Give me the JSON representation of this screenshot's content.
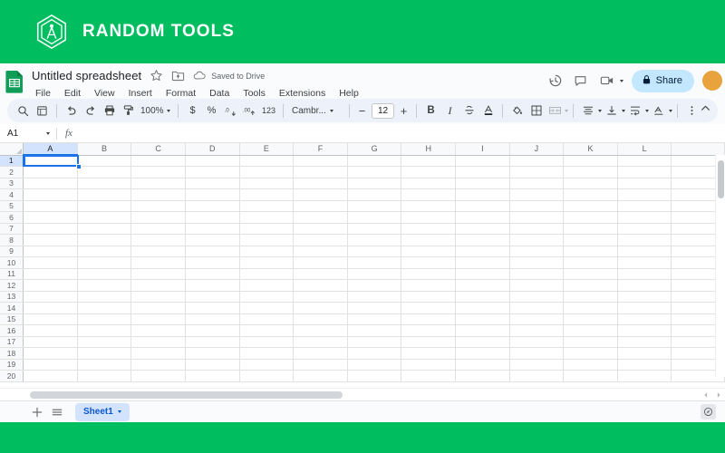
{
  "brand": {
    "name": "RANDOM TOOLS",
    "logo_icon": "hexagon-compass-icon",
    "banner_color": "#00bd60"
  },
  "document": {
    "app_icon": "google-sheets-icon",
    "title": "Untitled spreadsheet",
    "star_icon": "star-icon",
    "move_icon": "move-to-folder-icon",
    "cloud_icon": "cloud-saved-icon",
    "save_status": "Saved to Drive"
  },
  "menubar": {
    "items": [
      {
        "label": "File",
        "name": "menu-file"
      },
      {
        "label": "Edit",
        "name": "menu-edit"
      },
      {
        "label": "View",
        "name": "menu-view"
      },
      {
        "label": "Insert",
        "name": "menu-insert"
      },
      {
        "label": "Format",
        "name": "menu-format"
      },
      {
        "label": "Data",
        "name": "menu-data"
      },
      {
        "label": "Tools",
        "name": "menu-tools"
      },
      {
        "label": "Extensions",
        "name": "menu-extensions"
      },
      {
        "label": "Help",
        "name": "menu-help"
      }
    ]
  },
  "header_actions": {
    "history_icon": "version-history-icon",
    "comment_icon": "comment-icon",
    "meet_icon": "video-call-icon",
    "share_label": "Share",
    "share_lock_icon": "lock-icon",
    "share_bg": "#c2e7ff",
    "avatar_color": "#e8a33d"
  },
  "toolbar": {
    "search_icon": "search-icon",
    "menus_icon": "all-menus-icon",
    "undo_icon": "undo-icon",
    "redo_icon": "redo-icon",
    "print_icon": "print-icon",
    "paint_icon": "paint-format-icon",
    "zoom_value": "100%",
    "currency_label": "$",
    "percent_label": "%",
    "decimal_dec_icon": "decrease-decimal-icon",
    "decimal_inc_icon": "increase-decimal-icon",
    "number_format_label": "123",
    "font_name": "Cambr...",
    "font_size": "12",
    "font_size_minus": "−",
    "font_size_plus": "+",
    "bold_label": "B",
    "italic_label": "I",
    "strike_icon": "strikethrough-icon",
    "textcolor_icon": "text-color-icon",
    "fillcolor_icon": "fill-color-icon",
    "borders_icon": "borders-icon",
    "merge_icon": "merge-cells-icon",
    "halign_icon": "horizontal-align-icon",
    "valign_icon": "vertical-align-icon",
    "wrap_icon": "text-wrap-icon",
    "rotate_icon": "text-rotation-icon",
    "more_icon": "more-options-icon",
    "collapse_icon": "collapse-toolbar-icon"
  },
  "formula_bar": {
    "name_box": "A1",
    "fx_label": "fx",
    "formula_value": "",
    "formula_placeholder": ""
  },
  "grid": {
    "columns": [
      "A",
      "B",
      "C",
      "D",
      "E",
      "F",
      "G",
      "H",
      "I",
      "J",
      "K",
      "L"
    ],
    "rows": [
      "1",
      "2",
      "3",
      "4",
      "5",
      "6",
      "7",
      "8",
      "9",
      "10",
      "11",
      "12",
      "13",
      "14",
      "15",
      "16",
      "17",
      "18",
      "19",
      "20"
    ],
    "active_cell": "A1",
    "active_column": "A",
    "active_row": "1",
    "selection_color": "#1a73e8"
  },
  "sheet_bar": {
    "add_icon": "add-sheet-icon",
    "all_sheets_icon": "all-sheets-icon",
    "tabs": [
      {
        "label": "Sheet1",
        "active": true
      }
    ],
    "tab_caret_icon": "chevron-down-icon",
    "explore_icon": "explore-icon"
  },
  "scrollbars": {
    "vertical_icon": "vertical-scrollbar",
    "horizontal_icon": "horizontal-scrollbar",
    "left_arrow_icon": "scroll-left-icon",
    "right_arrow_icon": "scroll-right-icon"
  }
}
